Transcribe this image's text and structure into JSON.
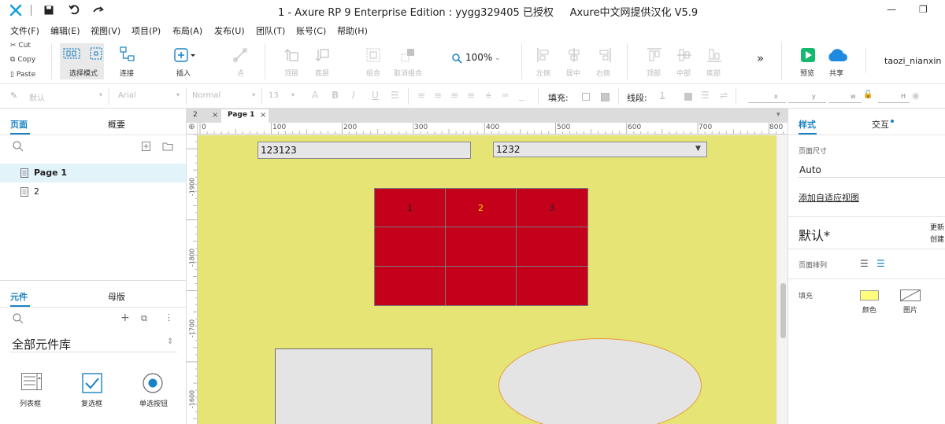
{
  "titlebar": {
    "title": "1 - Axure RP 9 Enterprise Edition : yygg329405 已授权     Axure中文网提供汉化 V5.9",
    "minimize": "—",
    "restore": "❐"
  },
  "menu": [
    "文件(F)",
    "编辑(E)",
    "视图(V)",
    "项目(P)",
    "布局(A)",
    "发布(U)",
    "团队(T)",
    "账号(C)",
    "帮助(H)"
  ],
  "clipboard": {
    "cut": "Cut",
    "copy": "Copy",
    "paste": "Paste"
  },
  "toolbar": {
    "select_mode": "选择模式",
    "connect": "连接",
    "insert": "插入",
    "point": "点",
    "top_layer": "顶层",
    "bottom_layer": "底层",
    "group": "组合",
    "ungroup": "取消组合",
    "zoom": "100%",
    "align_left": "左侧",
    "align_center": "居中",
    "align_right": "右侧",
    "align_top": "顶部",
    "align_middle": "中部",
    "align_bottom": "底部",
    "more": "»",
    "preview": "预览",
    "share": "共享",
    "user": "taozi_nianxin"
  },
  "formatbar": {
    "style": "默认",
    "font": "Arial",
    "weight": "Normal",
    "size": "13",
    "fill_label": "填充:",
    "line_label": "线段:",
    "line_value": "1",
    "x_label": "x",
    "y_label": "y",
    "w_label": "w",
    "h_label": "H"
  },
  "left_panel": {
    "tabs": [
      "页面",
      "概要"
    ],
    "pages": [
      "Page 1",
      "2"
    ],
    "lib_tabs": [
      "元件",
      "母版"
    ],
    "library": "全部元件库",
    "widgets": [
      "列表框",
      "复选框",
      "单选按钮"
    ]
  },
  "canvas": {
    "tabs": [
      "2",
      "Page 1"
    ],
    "ruler_h": [
      "0",
      "100",
      "200",
      "300",
      "400",
      "500",
      "600",
      "700",
      "800"
    ],
    "ruler_v": [
      "-1900",
      "-1800",
      "-1700",
      "-1600"
    ],
    "textbox_value": "123123",
    "dropdown_value": "1232",
    "table_cells": [
      "1",
      "2",
      "3",
      "",
      "",
      "",
      "",
      "",
      ""
    ],
    "colors": {
      "page_bg": "#e5e474",
      "table_fill": "#c4001b",
      "cell_highlight": "#f3e200",
      "ellipse_border": "#e79a3a"
    }
  },
  "right_panel": {
    "tabs": [
      "样式",
      "交互"
    ],
    "page_size_label": "页面尺寸",
    "page_size_value": "Auto",
    "adaptive_link": "添加自适应视图",
    "style_name": "默认*",
    "update": "更新",
    "create": "创建",
    "page_align_label": "页面排列",
    "fill_label": "填充",
    "fill_color_label": "颜色",
    "fill_image_label": "图片"
  }
}
